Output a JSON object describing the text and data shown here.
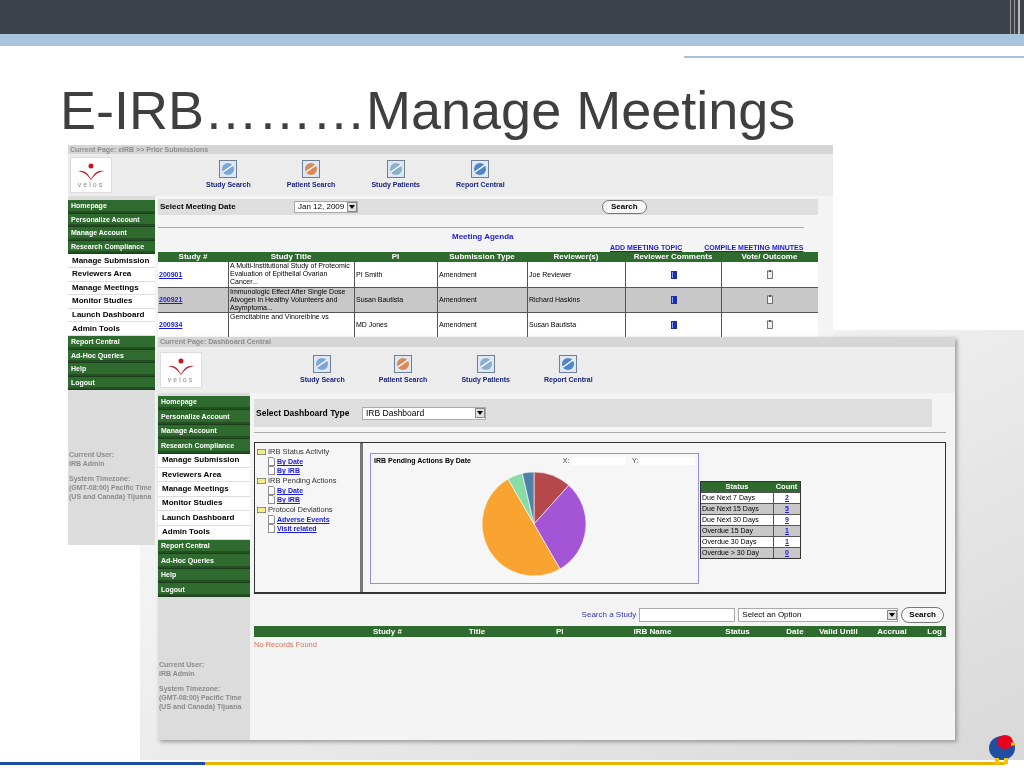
{
  "slide": {
    "title": "E-IRB………Manage Meetings"
  },
  "back_screen": {
    "breadcrumb": "Current Page: eIRB >> Prior Submissions",
    "logo_text": "velos",
    "toolbar": [
      "Study Search",
      "Patient Search",
      "Study Patients",
      "Report Central"
    ],
    "sidebar": [
      {
        "label": "Homepage",
        "kind": "group"
      },
      {
        "label": "Personalize Account",
        "kind": "group"
      },
      {
        "label": "Manage Account",
        "kind": "group"
      },
      {
        "label": "Research Compliance",
        "kind": "group"
      },
      {
        "label": "Manage Submission",
        "kind": "link"
      },
      {
        "label": "Reviewers Area",
        "kind": "link"
      },
      {
        "label": "Manage Meetings",
        "kind": "link"
      },
      {
        "label": "Monitor Studies",
        "kind": "link"
      },
      {
        "label": "Launch Dashboard",
        "kind": "link"
      },
      {
        "label": "Admin Tools",
        "kind": "link"
      },
      {
        "label": "Report Central",
        "kind": "group"
      },
      {
        "label": "Ad-Hoc Queries",
        "kind": "group"
      },
      {
        "label": "Help",
        "kind": "group"
      },
      {
        "label": "Logout",
        "kind": "group"
      }
    ],
    "user_info": {
      "user_label": "Current User:",
      "user": "IRB Admin",
      "timezone_label": "System Timezone:",
      "timezone": "(GMT-08:00) Pacific Time (US and Canada) Tijuana"
    },
    "meeting_date_label": "Select Meeting Date",
    "meeting_date": "Jan 12, 2009",
    "search_button": "Search",
    "agenda_title": "Meeting Agenda",
    "links": [
      "ADD MEETING TOPIC",
      "COMPILE MEETING MINUTES"
    ],
    "table": {
      "columns": [
        "Study #",
        "Study Title",
        "PI",
        "Submission Type",
        "Reviewer(s)",
        "Reviewer Comments",
        "Vote/ Outcome"
      ],
      "rows": [
        {
          "study": "200901",
          "title": "A Multi-Institutional Study of Proteomic Evaluation of Epithelial Ovarian Cancer...",
          "pi": "PI Smith",
          "type": "Amendment",
          "reviewer": "Joe Reviewer"
        },
        {
          "study": "200921",
          "title": "Immunologic Effect After Single Dose Atvogen in Healthy Volunteers and Asymptoma...",
          "pi": "Susan Bautista",
          "type": "Amendment",
          "reviewer": "Richard Haskins"
        },
        {
          "study": "200934",
          "title": "Gemcitabine and Vinorelbine vs",
          "pi": "MD Jones",
          "type": "Amendment",
          "reviewer": "Susan Bautista"
        }
      ]
    }
  },
  "front_screen": {
    "breadcrumb": "Current Page: Dashboard Central",
    "logo_text": "velos",
    "toolbar": [
      "Study Search",
      "Patient Search",
      "Study Patients",
      "Report Central"
    ],
    "sidebar": [
      {
        "label": "Homepage",
        "kind": "group"
      },
      {
        "label": "Personalize Account",
        "kind": "group"
      },
      {
        "label": "Manage Account",
        "kind": "group"
      },
      {
        "label": "Research Compliance",
        "kind": "group"
      },
      {
        "label": "Manage Submission",
        "kind": "link"
      },
      {
        "label": "Reviewers Area",
        "kind": "link"
      },
      {
        "label": "Manage Meetings",
        "kind": "link"
      },
      {
        "label": "Monitor Studies",
        "kind": "link"
      },
      {
        "label": "Launch Dashboard",
        "kind": "link"
      },
      {
        "label": "Admin Tools",
        "kind": "link"
      },
      {
        "label": "Report Central",
        "kind": "group"
      },
      {
        "label": "Ad-Hoc Queries",
        "kind": "group"
      },
      {
        "label": "Help",
        "kind": "group"
      },
      {
        "label": "Logout",
        "kind": "group"
      }
    ],
    "user_info": {
      "user_label": "Current User:",
      "user": "IRB Admin",
      "timezone_label": "System Timezone:",
      "timezone": "(GMT-08:00) Pacific Time (US and Canada) Tijuana"
    },
    "dashboard_type_label": "Select Dashboard Type",
    "dashboard_type": "IRB Dashboard",
    "tree": [
      {
        "label": "IRB Status Activity",
        "children": [
          {
            "label": "By Date"
          },
          {
            "label": "By IRB"
          }
        ]
      },
      {
        "label": "IRB Pending Actions",
        "children": [
          {
            "label": "By Date"
          },
          {
            "label": "By IRB"
          }
        ]
      },
      {
        "label": "Protocol Deviations",
        "children": [
          {
            "label": "Adverse Events"
          },
          {
            "label": "Visit related"
          }
        ]
      }
    ],
    "chart": {
      "title": "IRB Pending Actions By Date",
      "x_label": "X:",
      "y_label": "Y:"
    },
    "status_table": {
      "columns": [
        "Status",
        "Count"
      ],
      "rows": [
        {
          "status": "Due Next 7 Days",
          "count": "2"
        },
        {
          "status": "Due Next 15 Days",
          "count": "5"
        },
        {
          "status": "Due Next 30 Days",
          "count": "9"
        },
        {
          "status": "Overdue 15 Day",
          "count": "1"
        },
        {
          "status": "Overdue 30 Days",
          "count": "1"
        },
        {
          "status": "Overdue > 30 Day",
          "count": "0"
        }
      ]
    },
    "search": {
      "label": "Search a Study",
      "select": "Select an Option",
      "button": "Search"
    },
    "results": {
      "columns": [
        "Study #",
        "Title",
        "PI",
        "IRB Name",
        "Status",
        "Date",
        "Valid Until",
        "Accrual",
        "Log"
      ],
      "empty_message": "No Records Found"
    }
  }
}
